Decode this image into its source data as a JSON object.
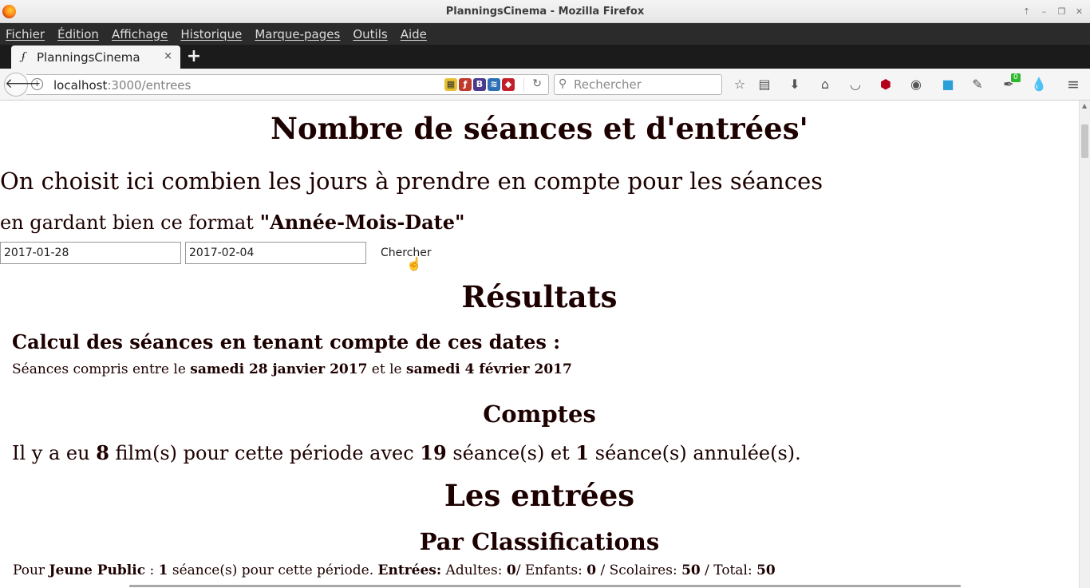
{
  "window": {
    "title": "PlanningsCinema - Mozilla Firefox",
    "controls": [
      "⇡",
      "–",
      "❐",
      "✕"
    ]
  },
  "menu": [
    "Fichier",
    "Édition",
    "Affichage",
    "Historique",
    "Marque-pages",
    "Outils",
    "Aide"
  ],
  "tab": {
    "label": "PlanningsCinema",
    "close": "×",
    "new_tab": "+"
  },
  "nav": {
    "url_host": "localhost",
    "url_rest": ":3000/entrees",
    "search_placeholder": "Rechercher",
    "badge": "0",
    "icons": [
      "back-icon",
      "info-icon",
      "reload-icon",
      "search-icon",
      "bookmark-star-icon",
      "reader-icon",
      "download-icon",
      "home-icon",
      "pocket-icon",
      "ublock-icon",
      "color-picker-icon",
      "skype-icon",
      "pen-icon",
      "extension-badge-icon",
      "drop-icon",
      "menu-icon"
    ]
  },
  "page": {
    "title": "Nombre de séances et d'entrées'",
    "intro_line1": "On choisit ici combien les jours à prendre en compte pour les séances",
    "intro_line2_pre": "en gardant bien ce format ",
    "intro_line2_format": "\"Année-Mois-Date\"",
    "start_date": "2017-01-28",
    "end_date": "2017-02-04",
    "search_button": "Chercher",
    "results_title": "Résultats",
    "calc_title": "Calcul des séances en tenant compte de ces dates :",
    "range_pre": "Séances compris entre le ",
    "range_start": "samedi 28 janvier 2017",
    "range_mid": " et le ",
    "range_end": "samedi 4 février 2017",
    "counts_title": "Comptes",
    "counts_pre": "Il y a eu ",
    "films": "8",
    "counts_mid1": " film(s) pour cette période avec ",
    "seances": "19",
    "counts_mid2": " séance(s) et ",
    "cancelled": "1",
    "counts_post": " séance(s) annulée(s).",
    "entries_title": "Les entrées",
    "class_title": "Par Classifications",
    "class_row": {
      "pre": "Pour ",
      "classification": "Jeune Public",
      "sep1": " : ",
      "count": "1",
      "mid": " séance(s) pour cette période. ",
      "entries_label": "Entrées:",
      "adults_label": " Adultes: ",
      "adults": "0",
      "children_label": "/ Enfants: ",
      "children": "0",
      "schools_label": " / Scolaires: ",
      "schools": "50",
      "total_label": " / Total: ",
      "total": "50"
    }
  }
}
